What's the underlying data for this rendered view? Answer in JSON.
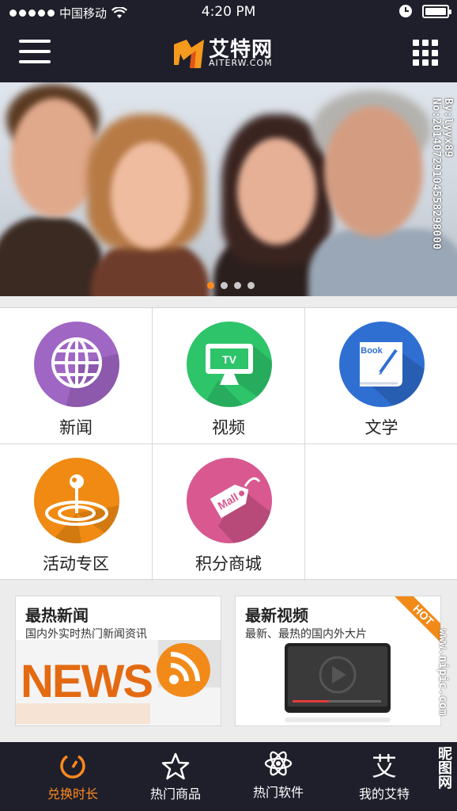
{
  "status_bar": {
    "carrier": "中国移动",
    "time": "4:20 PM"
  },
  "header": {
    "logo_text": "艾特网",
    "logo_sub": "AITERW.COM"
  },
  "banner": {
    "watermark": "By:lyyx89 No:20140729104558298000",
    "pager_count": 4,
    "pager_active": 1
  },
  "categories": [
    {
      "label": "新闻",
      "icon": "globe-icon",
      "color": "#a066c4"
    },
    {
      "label": "视频",
      "icon": "tv-icon",
      "icon_text": "TV",
      "color": "#2dc46a"
    },
    {
      "label": "文学",
      "icon": "book-icon",
      "icon_text": "Book",
      "color": "#2f6fd2"
    },
    {
      "label": "活动专区",
      "icon": "location-pin-icon",
      "color": "#f08a12"
    },
    {
      "label": "积分商城",
      "icon": "tag-icon",
      "icon_text": "Mall",
      "color": "#d8588f"
    }
  ],
  "cards": [
    {
      "title": "最热新闻",
      "desc": "国内外实时热门新闻资讯",
      "image_text": "NEWS"
    },
    {
      "title": "最新视频",
      "desc": "最新、最热的国内外大片",
      "badge": "HOT"
    }
  ],
  "side_watermark": "www.nipic.com",
  "corner_watermark": "昵图网",
  "tabs": [
    {
      "label": "兑换时长",
      "icon": "timer-icon",
      "active": true
    },
    {
      "label": "热门商品",
      "icon": "star-icon",
      "active": false
    },
    {
      "label": "热门软件",
      "icon": "atom-icon",
      "active": false
    },
    {
      "label": "我的艾特",
      "icon": "ai-character-icon",
      "icon_text": "艾",
      "active": false
    }
  ],
  "colors": {
    "bar_background": "#1f1f2b",
    "accent": "#ff8a1e"
  }
}
